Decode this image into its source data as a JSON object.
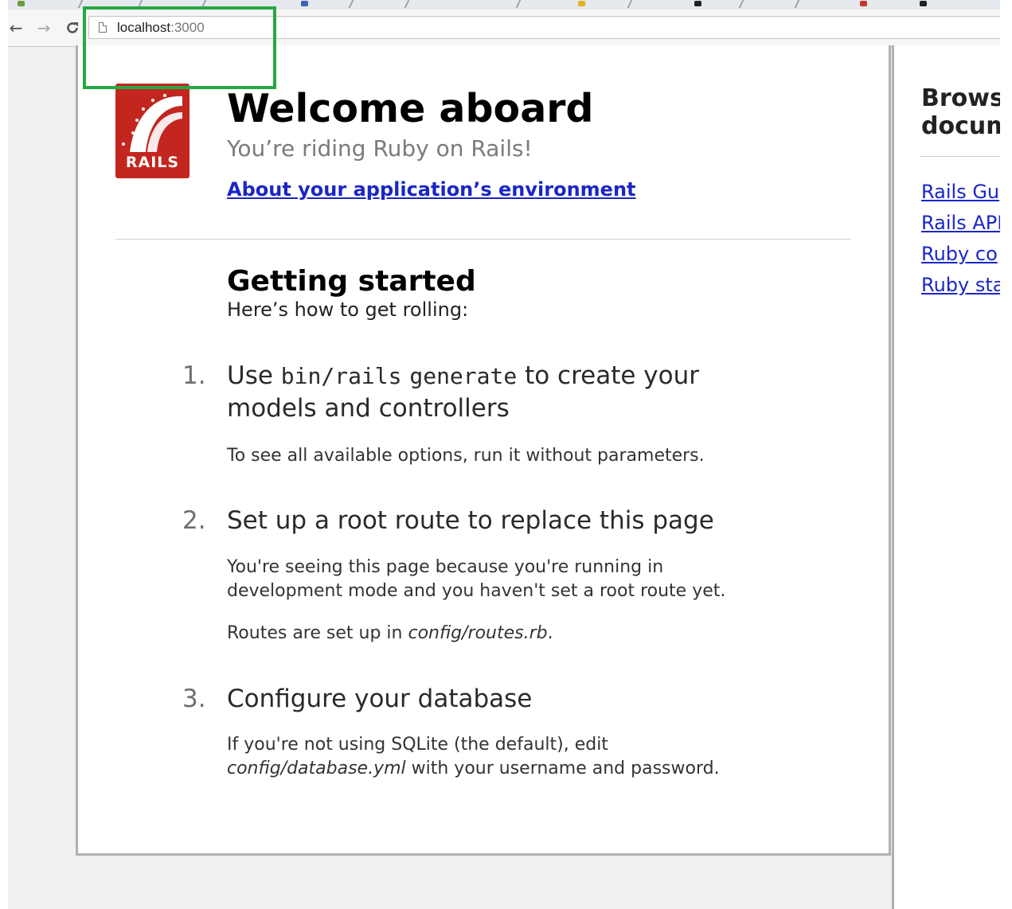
{
  "browser": {
    "back_icon": "back-arrow-icon",
    "forward_icon": "forward-arrow-icon",
    "reload_icon": "reload-icon",
    "url_host": "localhost",
    "url_port": ":3000"
  },
  "header": {
    "logo_text": "RAILS",
    "title": "Welcome aboard",
    "subtitle": "You’re riding Ruby on Rails!",
    "env_link": "About your application’s environment"
  },
  "getting_started": {
    "title": "Getting started",
    "subtitle": "Here’s how to get rolling:",
    "steps": [
      {
        "number": "1.",
        "title_pre": "Use",
        "code1": "bin/rails",
        "code2": "generate",
        "title_post": "to create your",
        "title_line2": "models and controllers",
        "desc": "To see all available options, run it without parameters."
      },
      {
        "number": "2.",
        "title": "Set up a root route to replace this page",
        "desc_line1": "You're seeing this page because you're running in",
        "desc_line2": "development mode and you haven't set a root route yet.",
        "routes_pre": "Routes are set up in",
        "routes_file": "config/routes.rb",
        "routes_post": "."
      },
      {
        "number": "3.",
        "title": "Configure your database",
        "desc_line1": "If you're not using SQLite (the default), edit",
        "db_file": "config/database.yml",
        "desc_line2_post": "with your username and password."
      }
    ]
  },
  "sidebar": {
    "heading_line1": "Brows",
    "heading_line2": "docum",
    "links": [
      "Rails Gu",
      "Rails API",
      "Ruby co",
      "Ruby sta"
    ]
  },
  "colors": {
    "link": "#1a26c7",
    "rails_red": "#c3261f",
    "highlight": "#27a844"
  }
}
